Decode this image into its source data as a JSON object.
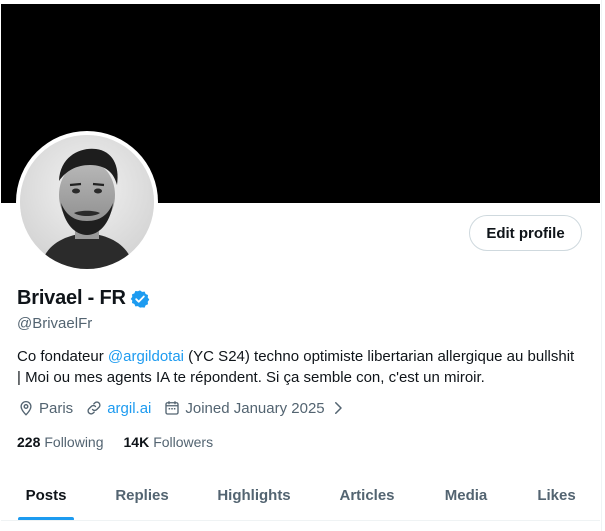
{
  "profile": {
    "name": "Brivael - FR",
    "handle": "@BrivaelFr",
    "edit_label": "Edit profile",
    "bio": {
      "before": "Co fondateur ",
      "mention": "@argildotai",
      "after": " (YC S24) techno optimiste libertarian allergique au bullshit | Moi ou mes agents IA te répondent. Si ça semble con, c'est un miroir."
    },
    "location": "Paris",
    "website": "argil.ai",
    "joined": "Joined January 2025",
    "following_count": "228",
    "following_label": "Following",
    "followers_count": "14K",
    "followers_label": "Followers"
  },
  "tabs": [
    {
      "label": "Posts",
      "active": true
    },
    {
      "label": "Replies"
    },
    {
      "label": "Highlights"
    },
    {
      "label": "Articles"
    },
    {
      "label": "Media"
    },
    {
      "label": "Likes"
    }
  ],
  "colors": {
    "accent": "#1d9bf0",
    "banner": "#000000",
    "muted": "#536471",
    "text": "#0f1419"
  }
}
